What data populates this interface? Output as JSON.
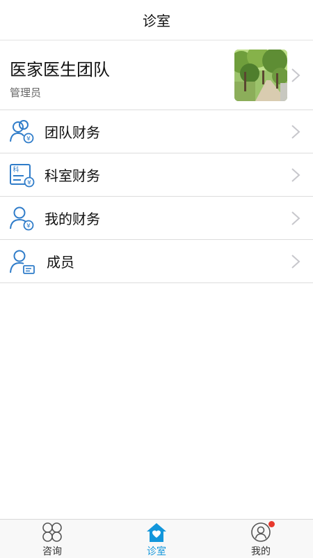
{
  "header": {
    "title": "诊室"
  },
  "team": {
    "name": "医家医生团队",
    "role": "管理员"
  },
  "menu": [
    {
      "label": "团队财务",
      "icon": "team-finance-icon"
    },
    {
      "label": "科室财务",
      "icon": "department-finance-icon",
      "icon_text": "科"
    },
    {
      "label": "我的财务",
      "icon": "my-finance-icon"
    },
    {
      "label": "成员",
      "icon": "members-icon"
    }
  ],
  "tabs": [
    {
      "label": "咨询",
      "icon": "consult-icon",
      "active": false
    },
    {
      "label": "诊室",
      "icon": "clinic-home-icon",
      "active": true
    },
    {
      "label": "我的",
      "icon": "profile-icon",
      "active": false,
      "badge": true
    }
  ],
  "colors": {
    "accent": "#1296db",
    "icon_blue": "#2f7cc9",
    "inactive": "#555555",
    "badge": "#e8392d",
    "chevron": "#c7c7cc"
  }
}
